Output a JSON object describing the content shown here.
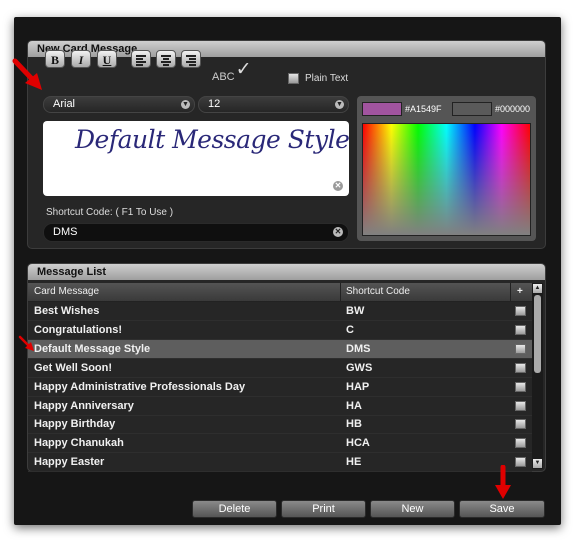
{
  "editor": {
    "title": "New Card Message",
    "bold_label": "B",
    "italic_label": "I",
    "underline_label": "U",
    "spellcheck_label": "ABC",
    "spellcheck_mark": "✓",
    "plain_text_label": "Plain Text",
    "plain_text_checked": false,
    "font_family_value": "Arial",
    "font_size_value": "12",
    "message_text": "Default Message Style",
    "shortcut_label": "Shortcut Code: ( F1 To Use )",
    "shortcut_value": "DMS"
  },
  "colors": {
    "primary_label": "#A1549F",
    "primary_swatch": "#A1549F",
    "secondary_label": "#000000",
    "secondary_swatch": "#5a5a5a"
  },
  "message_list": {
    "title": "Message List",
    "columns": [
      "Card Message",
      "Shortcut Code",
      "+"
    ],
    "rows": [
      {
        "message": "Best Wishes",
        "code": "BW",
        "selected": false
      },
      {
        "message": "Congratulations!",
        "code": "C",
        "selected": false
      },
      {
        "message": "Default Message Style",
        "code": "DMS",
        "selected": true
      },
      {
        "message": "Get Well Soon!",
        "code": "GWS",
        "selected": false
      },
      {
        "message": "Happy Administrative Professionals Day",
        "code": "HAP",
        "selected": false
      },
      {
        "message": "Happy Anniversary",
        "code": "HA",
        "selected": false
      },
      {
        "message": "Happy Birthday",
        "code": "HB",
        "selected": false
      },
      {
        "message": "Happy Chanukah",
        "code": "HCA",
        "selected": false
      },
      {
        "message": "Happy Easter",
        "code": "HE",
        "selected": false
      }
    ]
  },
  "footer": {
    "delete_label": "Delete",
    "print_label": "Print",
    "new_label": "New",
    "save_label": "Save"
  }
}
